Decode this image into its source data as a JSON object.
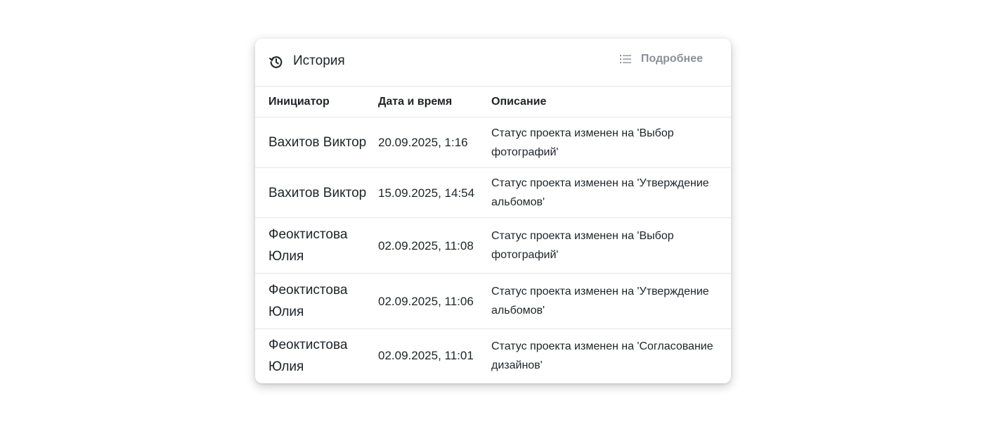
{
  "panel": {
    "title": "История",
    "title_icon": "history-icon",
    "more_label": "Подробнее",
    "more_icon": "list-icon"
  },
  "table": {
    "headers": {
      "initiator": "Инициатор",
      "datetime": "Дата и время",
      "description": "Описание"
    },
    "rows": [
      {
        "initiator": "Вахитов Виктор",
        "datetime": "20.09.2025, 1:16",
        "description": "Статус проекта изменен на 'Выбор фотографий'"
      },
      {
        "initiator": "Вахитов Виктор",
        "datetime": "15.09.2025, 14:54",
        "description": "Статус проекта изменен на 'Утверждение альбомов'"
      },
      {
        "initiator": "Феоктистова Юлия",
        "datetime": "02.09.2025, 11:08",
        "description": "Статус проекта изменен на 'Выбор фотографий'"
      },
      {
        "initiator": "Феоктистова Юлия",
        "datetime": "02.09.2025, 11:06",
        "description": "Статус проекта изменен на 'Утверждение альбомов'"
      },
      {
        "initiator": "Феоктистова Юлия",
        "datetime": "02.09.2025, 11:01",
        "description": "Статус проекта изменен на 'Согласование дизайнов'"
      }
    ]
  },
  "colors": {
    "text": "#1f2328",
    "muted": "#8b9199",
    "divider": "#e4e6ea"
  }
}
